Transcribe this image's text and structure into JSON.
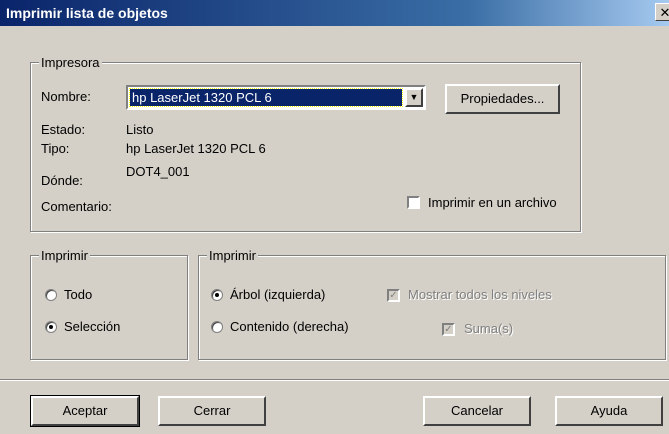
{
  "window": {
    "title": "Imprimir lista de objetos",
    "close_glyph": "✕"
  },
  "printer": {
    "legend": "Impresora",
    "name_label": "Nombre:",
    "name_value": "hp LaserJet 1320 PCL 6",
    "properties_button": "Propiedades...",
    "status_label": "Estado:",
    "status_value": "Listo",
    "type_label": "Tipo:",
    "type_value": "hp LaserJet 1320 PCL 6",
    "where_label": "Dónde:",
    "where_value": "DOT4_001",
    "comment_label": "Comentario:",
    "print_to_file_label": "Imprimir en un archivo",
    "print_to_file_checked": false
  },
  "print_range": {
    "legend": "Imprimir",
    "options": [
      {
        "label": "Todo",
        "selected": false
      },
      {
        "label": "Selección",
        "selected": true
      }
    ]
  },
  "print_view": {
    "legend": "Imprimir",
    "options": [
      {
        "label": "Árbol (izquierda)",
        "selected": true
      },
      {
        "label": "Contenido (derecha)",
        "selected": false
      }
    ],
    "show_all_levels_label": "Mostrar todos los niveles",
    "show_all_levels_checked": true,
    "sums_label": "Suma(s)",
    "sums_checked": true
  },
  "buttons": {
    "accept": "Aceptar",
    "close": "Cerrar",
    "cancel": "Cancelar",
    "help": "Ayuda"
  },
  "icons": {
    "dropdown_arrow": "▼",
    "check": "✓"
  },
  "colors": {
    "titlebar_start": "#0a246a",
    "dialog_bg": "#d4d0c8",
    "selection_bg": "#0a246a"
  }
}
